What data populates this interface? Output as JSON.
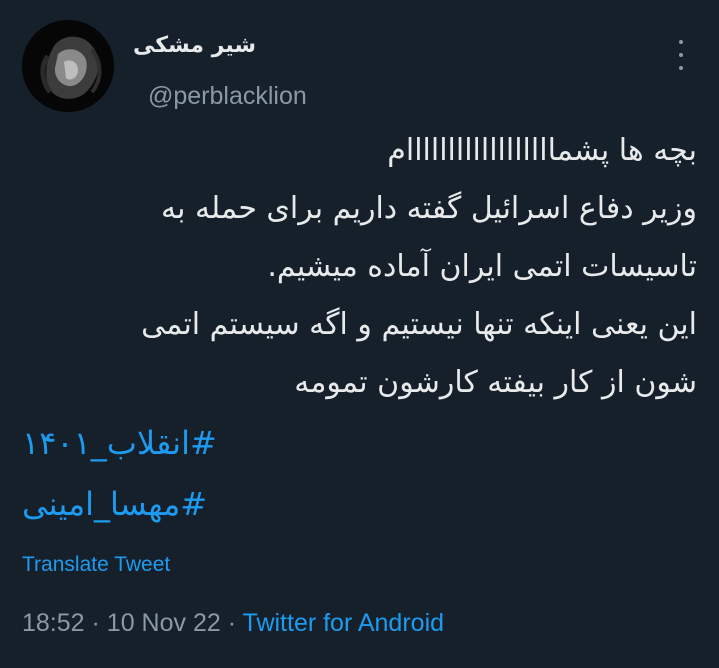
{
  "tweet": {
    "author": {
      "display_name": "شیر مشکی",
      "handle": "@perblacklion"
    },
    "text_lines": [
      "بچه ها پشماااااااااااااااااام",
      "وزیر دفاع اسرائیل گفته داریم برای حمله به",
      "تاسیسات اتمی ایران آماده میشیم.",
      "این یعنی اینکه تنها نیستیم و اگه سیستم اتمی",
      "شون از کار بیفته کارشون تمومه"
    ],
    "hashtags": [
      "#انقلاب_۱۴۰۱",
      "#مهسا_امینی"
    ],
    "translate_label": "Translate Tweet",
    "time": "18:52",
    "separator": "·",
    "date": "10 Nov 22",
    "source": "Twitter for Android"
  },
  "icons": {
    "more": "more-vertical-icon",
    "avatar": "black-lion-photo"
  },
  "colors": {
    "background": "#15202b",
    "text": "#e7e9ea",
    "secondary": "#8b98a5",
    "accent": "#1d9bf0"
  }
}
